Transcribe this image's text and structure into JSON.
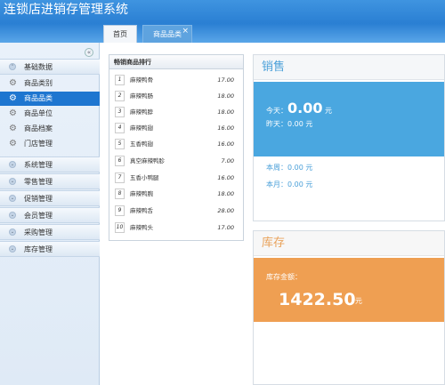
{
  "app": {
    "title": "连锁店进销存管理系统"
  },
  "tabs": [
    {
      "label": "首页"
    },
    {
      "label": "商品品类",
      "close": "×"
    }
  ],
  "sidebar": {
    "collapse_icon": "«",
    "groups": [
      {
        "label": "基础数据",
        "items": [
          "商品类别",
          "商品品类",
          "商品单位",
          "商品档案",
          "门店管理"
        ]
      },
      {
        "label": "系统管理"
      },
      {
        "label": "零售管理"
      },
      {
        "label": "促销管理"
      },
      {
        "label": "会员管理"
      },
      {
        "label": "采购管理"
      },
      {
        "label": "库存管理"
      }
    ],
    "active_item": "商品品类"
  },
  "ranking": {
    "title": "畅销商品排行",
    "rows": [
      {
        "rank": "1",
        "name": "麻辣鸭骨",
        "value": "17.00"
      },
      {
        "rank": "2",
        "name": "麻辣鸭肠",
        "value": "18.00"
      },
      {
        "rank": "3",
        "name": "麻辣鸭脖",
        "value": "18.00"
      },
      {
        "rank": "4",
        "name": "麻辣鸭翅",
        "value": "16.00"
      },
      {
        "rank": "5",
        "name": "五香鸭翅",
        "value": "16.00"
      },
      {
        "rank": "6",
        "name": "真空麻辣鸭胗",
        "value": "7.00"
      },
      {
        "rank": "7",
        "name": "五香小鸭腿",
        "value": "16.00"
      },
      {
        "rank": "8",
        "name": "麻辣鸭腕",
        "value": "18.00"
      },
      {
        "rank": "9",
        "name": "麻辣鸭舌",
        "value": "28.00"
      },
      {
        "rank": "10",
        "name": "麻辣鸭头",
        "value": "17.00"
      }
    ]
  },
  "sales": {
    "title": "销售",
    "today_label": "今天：",
    "today_value": "0.00",
    "today_unit": "元",
    "yesterday": "昨天：0.00 元",
    "week": "本周：0.00 元",
    "month": "本月：0.00 元"
  },
  "stock": {
    "title": "库存",
    "amount_label": "库存金额：",
    "amount_value": "1422.50",
    "amount_unit": "元"
  },
  "colors": {
    "header": "#2a7fd3",
    "sales": "#4aa7e0",
    "stock": "#ef9f52",
    "active_item": "#1e76d0"
  }
}
